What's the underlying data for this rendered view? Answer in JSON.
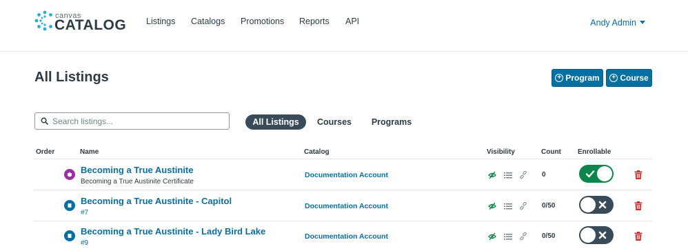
{
  "brand": {
    "small": "canvas",
    "big": "CATALOG"
  },
  "nav": [
    {
      "label": "Listings"
    },
    {
      "label": "Catalogs"
    },
    {
      "label": "Promotions"
    },
    {
      "label": "Reports"
    },
    {
      "label": "API"
    }
  ],
  "user": {
    "name": "Andy Admin"
  },
  "page": {
    "title": "All Listings"
  },
  "actions": {
    "program_label": "Program",
    "course_label": "Course"
  },
  "search": {
    "placeholder": "Search listings...",
    "value": ""
  },
  "tabs": [
    {
      "label": "All Listings",
      "active": true
    },
    {
      "label": "Courses",
      "active": false
    },
    {
      "label": "Programs",
      "active": false
    }
  ],
  "table": {
    "columns": {
      "order": "Order",
      "name": "Name",
      "catalog": "Catalog",
      "visibility": "Visibility",
      "count": "Count",
      "enrollable": "Enrollable"
    },
    "rows": [
      {
        "type": "program",
        "name": "Becoming a True Austinite",
        "subtitle": "Becoming a True Austinite Certificate",
        "catalog": "Documentation Account",
        "count": "0",
        "enrollable": true
      },
      {
        "type": "course",
        "name": "Becoming a True Austinite - Capitol",
        "subtitle": "#7",
        "catalog": "Documentation Account",
        "count": "0/50",
        "enrollable": false
      },
      {
        "type": "course",
        "name": "Becoming a True Austinite - Lady Bird Lake",
        "subtitle": "#9",
        "catalog": "Documentation Account",
        "count": "0/50",
        "enrollable": false
      }
    ]
  },
  "colors": {
    "accent": "#0770a3",
    "enrollable_on": "#0b874b",
    "enrollable_off": "#394b58",
    "delete": "#c5322b",
    "program_icon": "#9e2fa3",
    "visible_icon": "#0b874b"
  },
  "icons": {
    "logo": "canvas-logo-icon",
    "search": "search-icon",
    "program_type": "program-type-icon",
    "course_type": "course-type-icon",
    "visible": "eye-visible-icon",
    "list": "list-icon",
    "link": "link-icon",
    "check": "check-icon",
    "close": "close-icon",
    "delete": "trash-icon",
    "plus": "plus-circle-icon"
  }
}
